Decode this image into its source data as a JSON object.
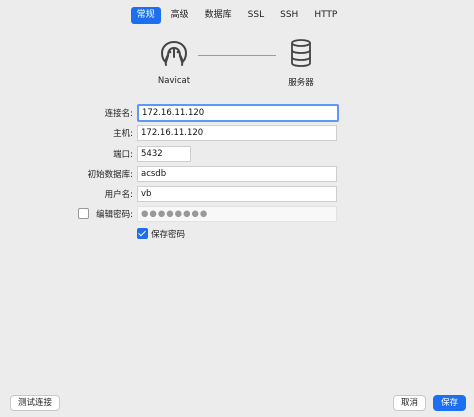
{
  "tabs": [
    {
      "label": "常规",
      "active": true
    },
    {
      "label": "高级",
      "active": false
    },
    {
      "label": "数据库",
      "active": false
    },
    {
      "label": "SSL",
      "active": false
    },
    {
      "label": "SSH",
      "active": false
    },
    {
      "label": "HTTP",
      "active": false
    }
  ],
  "diagram": {
    "client_label": "Navicat",
    "server_label": "服务器",
    "client_icon": "navicat-logo-icon",
    "server_icon": "database-icon"
  },
  "form": {
    "connection_name_label": "连接名:",
    "connection_name_value": "172.16.11.120",
    "host_label": "主机:",
    "host_value": "172.16.11.120",
    "port_label": "端口:",
    "port_value": "5432",
    "initial_db_label": "初始数据库:",
    "initial_db_value": "acsdb",
    "username_label": "用户名:",
    "username_value": "vb",
    "edit_password_label": "编辑密码:",
    "password_mask": "●●●●●●●●",
    "edit_password_checked": false,
    "save_password_label": "保存密码",
    "save_password_checked": true
  },
  "footer": {
    "test_connection_label": "测试连接",
    "cancel_label": "取消",
    "save_label": "保存"
  },
  "colors": {
    "accent": "#1d6ff2",
    "focus_ring": "#5a9bf1",
    "background": "#ececec"
  }
}
